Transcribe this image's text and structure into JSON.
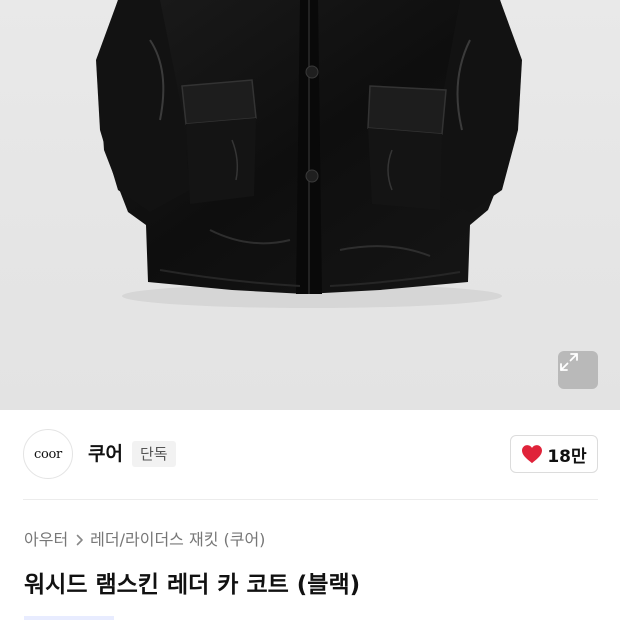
{
  "image": {
    "expand_icon": "expand-arrows-icon"
  },
  "brand": {
    "logo_text": "coor",
    "name": "쿠어",
    "badge": "단독"
  },
  "like": {
    "icon": "heart-icon",
    "count": "18만",
    "color": "#e0233a"
  },
  "breadcrumb": {
    "items": [
      "아우터",
      "레더/라이더스 재킷 (쿠어)"
    ],
    "separator_icon": "chevron-right-icon"
  },
  "product": {
    "title": "워시드 램스킨 레더 카 코트 (블랙)"
  }
}
